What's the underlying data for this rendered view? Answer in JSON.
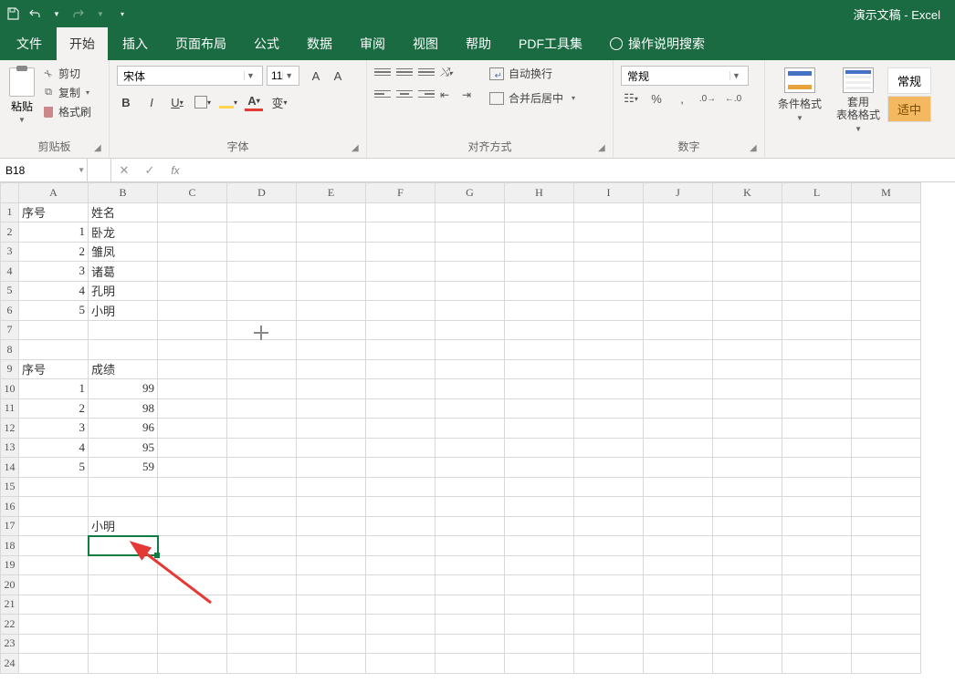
{
  "title": "演示文稿 - Excel",
  "tabs": [
    "文件",
    "开始",
    "插入",
    "页面布局",
    "公式",
    "数据",
    "审阅",
    "视图",
    "帮助",
    "PDF工具集"
  ],
  "active_tab": 1,
  "tell_me": "操作说明搜索",
  "clipboard": {
    "paste": "粘贴",
    "cut": "剪切",
    "copy": "复制",
    "format_painter": "格式刷",
    "group": "剪贴板"
  },
  "font": {
    "name": "宋体",
    "size": "11",
    "group": "字体"
  },
  "alignment": {
    "wrap": "自动换行",
    "merge": "合并后居中",
    "group": "对齐方式"
  },
  "number": {
    "format": "常规",
    "group": "数字"
  },
  "styles": {
    "cond_fmt": "条件格式",
    "format_table": "套用\n表格格式",
    "normal": "常规",
    "good": "适中"
  },
  "name_box": "B18",
  "columns": [
    "A",
    "B",
    "C",
    "D",
    "E",
    "F",
    "G",
    "H",
    "I",
    "J",
    "K",
    "L",
    "M"
  ],
  "row_count": 24,
  "cells": {
    "A1": "序号",
    "B1": "姓名",
    "A2": "1",
    "B2": "卧龙",
    "A3": "2",
    "B3": "雏凤",
    "A4": "3",
    "B4": "诸葛",
    "A5": "4",
    "B5": "孔明",
    "A6": "5",
    "B6": "小明",
    "A9": "序号",
    "B9": "成绩",
    "A10": "1",
    "B10": "99",
    "A11": "2",
    "B11": "98",
    "A12": "3",
    "B12": "96",
    "A13": "4",
    "B13": "95",
    "A14": "5",
    "B14": "59",
    "B17": "小明"
  },
  "numeric_cells": [
    "A2",
    "A3",
    "A4",
    "A5",
    "A6",
    "A10",
    "A11",
    "A12",
    "A13",
    "A14",
    "B10",
    "B11",
    "B12",
    "B13",
    "B14"
  ],
  "selected_cell": "B18",
  "cursor_pos": {
    "col": "D",
    "row": 7
  }
}
